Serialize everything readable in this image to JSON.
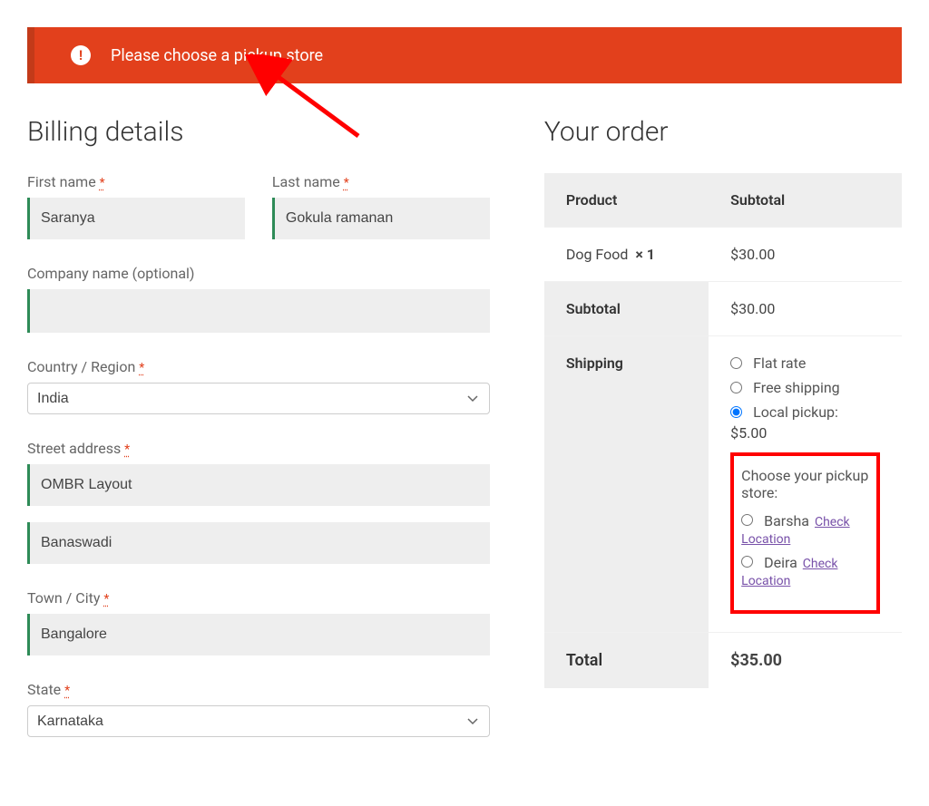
{
  "alert": {
    "message": "Please choose a pickup store"
  },
  "billing": {
    "heading": "Billing details",
    "labels": {
      "first_name": "First name",
      "last_name": "Last name",
      "company": "Company name (optional)",
      "country": "Country / Region",
      "street": "Street address",
      "city": "Town / City",
      "state": "State"
    },
    "values": {
      "first_name": "Saranya",
      "last_name": "Gokula ramanan",
      "company": "",
      "country": "India",
      "street1": "OMBR Layout",
      "street2": "Banaswadi",
      "city": "Bangalore",
      "state": "Karnataka"
    },
    "required_mark": "*"
  },
  "order": {
    "heading": "Your order",
    "columns": {
      "product": "Product",
      "subtotal": "Subtotal"
    },
    "items": [
      {
        "name": "Dog Food",
        "qty_prefix": "×",
        "qty": "1",
        "price": "$30.00"
      }
    ],
    "subtotal_label": "Subtotal",
    "subtotal_value": "$30.00",
    "shipping_label": "Shipping",
    "shipping_options": {
      "flat": "Flat rate",
      "free": "Free shipping",
      "local": "Local pickup:",
      "local_price": "$5.00"
    },
    "pickup_store": {
      "title": "Choose your pickup store:",
      "options": [
        {
          "name": "Barsha",
          "link": "Check Location"
        },
        {
          "name": "Deira",
          "link": "Check Location"
        }
      ]
    },
    "total_label": "Total",
    "total_value": "$35.00"
  }
}
